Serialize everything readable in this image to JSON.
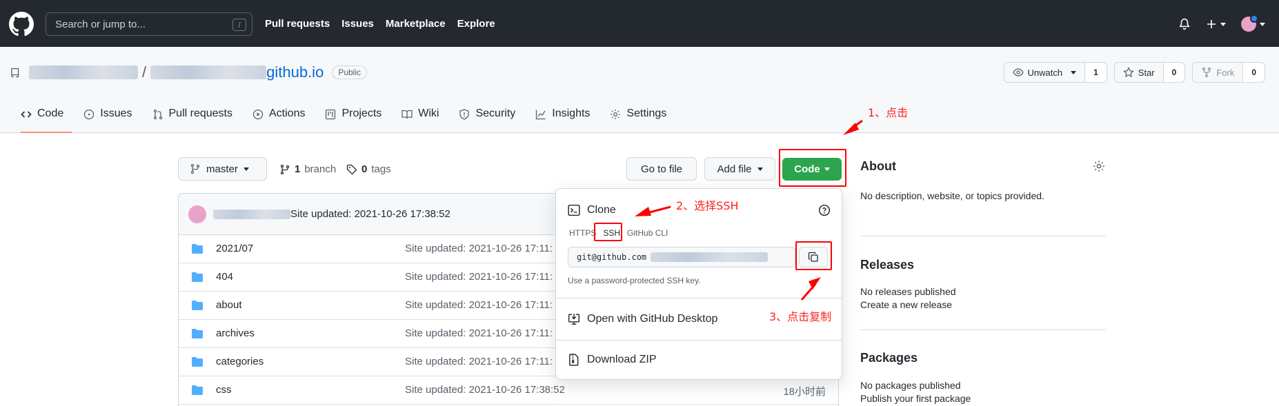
{
  "header": {
    "search_placeholder": "Search or jump to...",
    "search_shortcut": "/",
    "nav": [
      "Pull requests",
      "Issues",
      "Marketplace",
      "Explore"
    ]
  },
  "repo": {
    "separator": "/",
    "name_suffix": "github.io",
    "visibility": "Public",
    "unwatch_label": "Unwatch",
    "unwatch_count": "1",
    "star_label": "Star",
    "star_count": "0",
    "fork_label": "Fork",
    "fork_count": "0"
  },
  "tabs": [
    "Code",
    "Issues",
    "Pull requests",
    "Actions",
    "Projects",
    "Wiki",
    "Security",
    "Insights",
    "Settings"
  ],
  "main": {
    "branch": "master",
    "branch_count": "1",
    "branch_word": "branch",
    "tag_count": "0",
    "tag_word": "tags",
    "go_to_file": "Go to file",
    "add_file": "Add file",
    "code_button": "Code",
    "commit_message": "Site updated: 2021-10-26 17:38:52"
  },
  "files": [
    {
      "name": "2021/07",
      "msg": "Site updated: 2021-10-26 17:11:",
      "age": ""
    },
    {
      "name": "404",
      "msg": "Site updated: 2021-10-26 17:11:",
      "age": ""
    },
    {
      "name": "about",
      "msg": "Site updated: 2021-10-26 17:11:",
      "age": ""
    },
    {
      "name": "archives",
      "msg": "Site updated: 2021-10-26 17:11:",
      "age": ""
    },
    {
      "name": "categories",
      "msg": "Site updated: 2021-10-26 17:11:",
      "age": ""
    },
    {
      "name": "css",
      "msg": "Site updated: 2021-10-26 17:38:52",
      "age": "18小时前"
    }
  ],
  "dropdown": {
    "clone_title": "Clone",
    "protocols": [
      "HTTPS",
      "SSH",
      "GitHub CLI"
    ],
    "url_prefix": "git@github.com",
    "hint": "Use a password-protected SSH key.",
    "open_desktop": "Open with GitHub Desktop",
    "download_zip": "Download ZIP"
  },
  "sidebar": {
    "about_title": "About",
    "about_desc": "No description, website, or topics provided.",
    "releases_title": "Releases",
    "releases_none": "No releases published",
    "releases_link": "Create a new release",
    "packages_title": "Packages",
    "packages_none": "No packages published",
    "packages_link": "Publish your first package"
  },
  "annotations": {
    "step1": "1、点击",
    "step2": "2、选择SSH",
    "step3": "3、点击复制",
    "color": "#ff0000"
  }
}
